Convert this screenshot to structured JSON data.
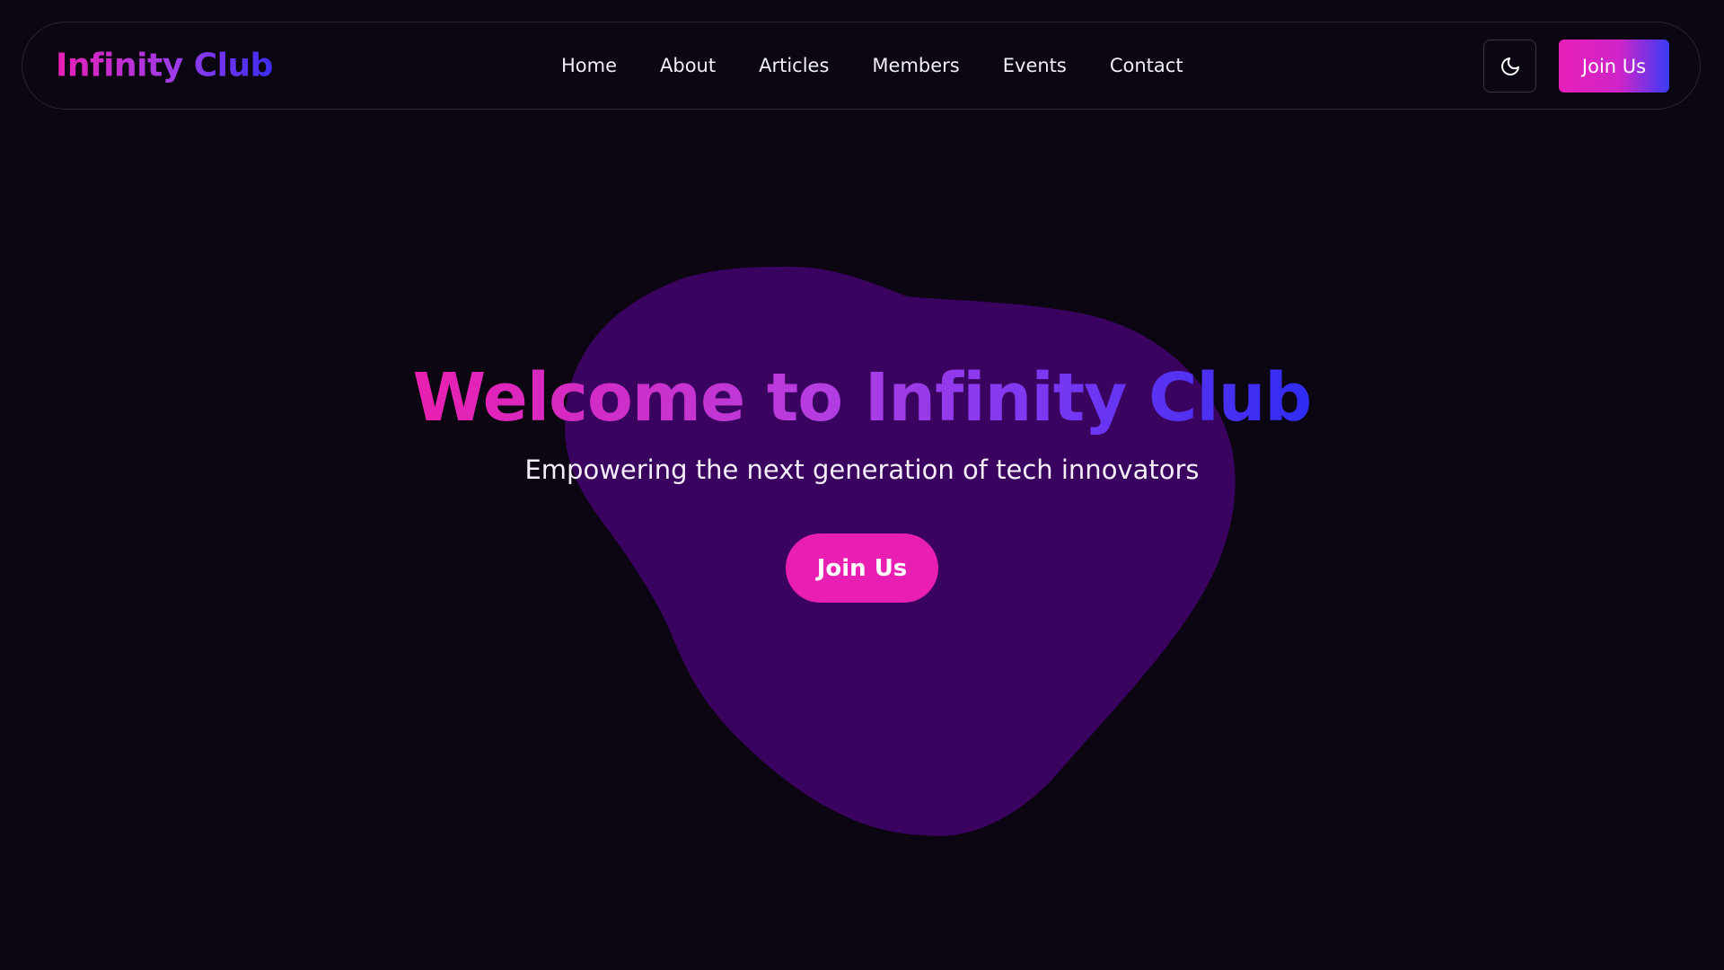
{
  "brand": {
    "name": "Infinity Club"
  },
  "nav": {
    "links": [
      {
        "label": "Home"
      },
      {
        "label": "About"
      },
      {
        "label": "Articles"
      },
      {
        "label": "Members"
      },
      {
        "label": "Events"
      },
      {
        "label": "Contact"
      }
    ],
    "theme_toggle_icon": "moon-icon",
    "join_label": "Join Us"
  },
  "hero": {
    "title": "Welcome to Infinity Club",
    "subtitle": "Empowering the next generation of tech innovators",
    "cta_label": "Join Us"
  },
  "colors": {
    "background": "#0b0612",
    "blob": "#3a0360",
    "accent_pink": "#e81fb2",
    "accent_blue": "#2f2cf3"
  }
}
